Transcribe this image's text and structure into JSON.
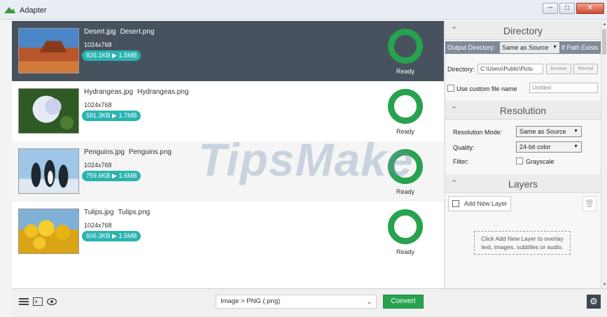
{
  "window": {
    "title": "Adapter"
  },
  "files": [
    {
      "source": "Desert.jpg",
      "target": "Desert.png",
      "resolution": "1024x768",
      "sizes": "826.1KB ▶ 1.5MB",
      "status": "Ready"
    },
    {
      "source": "Hydrangeas.jpg",
      "target": "Hydrangeas.png",
      "resolution": "1024x768",
      "sizes": "581.3KB ▶ 1.7MB",
      "status": "Ready"
    },
    {
      "source": "Penguins.jpg",
      "target": "Penguins.png",
      "resolution": "1024x768",
      "sizes": "759.6KB ▶ 1.6MB",
      "status": "Ready"
    },
    {
      "source": "Tulips.jpg",
      "target": "Tulips.png",
      "resolution": "1024x768",
      "sizes": "606.3KB ▶ 1.5MB",
      "status": "Ready"
    }
  ],
  "directory": {
    "title": "Directory",
    "output_label": "Output Directory:",
    "output_value": "Same as Source",
    "if_path_exists": "If Path Exists",
    "dir_label": "Directory:",
    "dir_value": "C:\\Users\\Public\\Pictu",
    "browse": "Browse",
    "reveal": "Reveal",
    "custom_name_label": "Use custom file name",
    "custom_name_placeholder": "Untitled"
  },
  "resolution": {
    "title": "Resolution",
    "mode_label": "Resolution Mode:",
    "mode_value": "Same as Source",
    "quality_label": "Quality:",
    "quality_value": "24-bit color",
    "filter_label": "Filter:",
    "grayscale_label": "Grayscale"
  },
  "layers": {
    "title": "Layers",
    "add_label": "Add New Layer",
    "hint_line1": "Click Add New Layer to overlay",
    "hint_line2": "text, images, subtitles or audio."
  },
  "bottom": {
    "format": "Image > PNG (.png)",
    "convert": "Convert"
  },
  "watermark": "TipsMake",
  "colors": {
    "accent": "#27a24f",
    "pill": "#2ab3b0",
    "selected_row": "#47525e"
  },
  "icons": [
    "app-icon",
    "list-view-icon",
    "preview-icon",
    "eye-icon",
    "chevron-up-icon",
    "chevron-down-icon",
    "layer-icon",
    "trash-icon",
    "gear-icon"
  ]
}
